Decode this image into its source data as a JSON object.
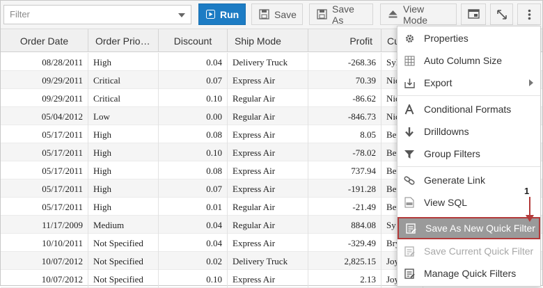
{
  "toolbar": {
    "filter_placeholder": "Filter",
    "run_label": "Run",
    "save_label": "Save",
    "save_as_label": "Save As",
    "view_mode_label": "View Mode"
  },
  "grid": {
    "columns": [
      "Order Date",
      "Order Prio…",
      "Discount",
      "Ship Mode",
      "Profit",
      "Cu"
    ],
    "rows": [
      [
        "08/28/2011",
        "High",
        "0.04",
        "Delivery Truck",
        "-268.36",
        "Syl"
      ],
      [
        "09/29/2011",
        "Critical",
        "0.07",
        "Express Air",
        "70.39",
        "Nic"
      ],
      [
        "09/29/2011",
        "Critical",
        "0.10",
        "Regular Air",
        "-86.62",
        "Nic"
      ],
      [
        "05/04/2012",
        "Low",
        "0.00",
        "Regular Air",
        "-846.73",
        "Nic"
      ],
      [
        "05/17/2011",
        "High",
        "0.08",
        "Express Air",
        "8.05",
        "Bet"
      ],
      [
        "05/17/2011",
        "High",
        "0.10",
        "Express Air",
        "-78.02",
        "Bet"
      ],
      [
        "05/17/2011",
        "High",
        "0.08",
        "Express Air",
        "737.94",
        "Bet"
      ],
      [
        "05/17/2011",
        "High",
        "0.07",
        "Express Air",
        "-191.28",
        "Bet"
      ],
      [
        "05/17/2011",
        "High",
        "0.01",
        "Regular Air",
        "-21.49",
        "Bet"
      ],
      [
        "11/17/2009",
        "Medium",
        "0.04",
        "Regular Air",
        "884.08",
        "Sy"
      ],
      [
        "10/10/2011",
        "Not Specified",
        "0.04",
        "Express Air",
        "-329.49",
        "Bry"
      ],
      [
        "10/07/2012",
        "Not Specified",
        "0.02",
        "Delivery Truck",
        "2,825.15",
        "Joy"
      ],
      [
        "10/07/2012",
        "Not Specified",
        "0.10",
        "Express Air",
        "2.13",
        "Joy"
      ]
    ]
  },
  "menu": {
    "items": [
      {
        "label": "Properties",
        "icon": "gear-icon"
      },
      {
        "label": "Auto Column Size",
        "icon": "grid-icon"
      },
      {
        "label": "Export",
        "icon": "export-icon"
      },
      {
        "label": "Conditional Formats",
        "icon": "format-a-icon"
      },
      {
        "label": "Drilldowns",
        "icon": "arrow-down-icon"
      },
      {
        "label": "Group Filters",
        "icon": "filter-icon"
      },
      {
        "label": "Generate Link",
        "icon": "link-icon"
      },
      {
        "label": "View SQL",
        "icon": "sql-file-icon"
      },
      {
        "label": "Save As New Quick Filter",
        "icon": "quick-filter-save-icon"
      },
      {
        "label": "Save Current Quick Filter",
        "icon": "quick-filter-icon"
      },
      {
        "label": "Manage Quick Filters",
        "icon": "quick-filter-manage-icon"
      }
    ]
  },
  "callout": {
    "number": "1"
  },
  "colors": {
    "accent": "#1d7cc4",
    "highlight": "#9a9a9a",
    "callout": "#b33a3a"
  }
}
